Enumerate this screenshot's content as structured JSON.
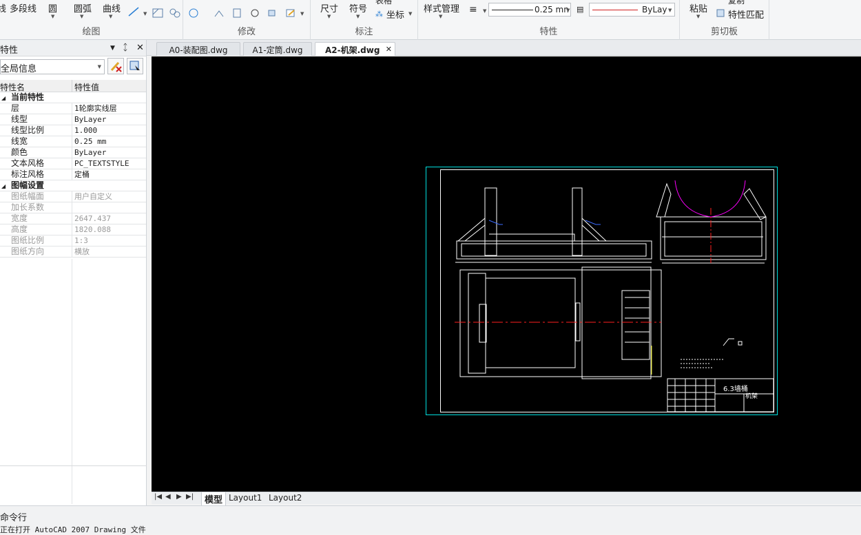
{
  "ribbon": {
    "draw": {
      "label": "绘图",
      "btn_line": "线",
      "btn_polyline": "多段线",
      "btn_circle": "圆",
      "btn_arc": "圆弧",
      "btn_curve": "曲线"
    },
    "modify": {
      "label": "修改"
    },
    "annotate": {
      "label": "标注",
      "btn_dimension": "尺寸",
      "btn_symbol": "符号",
      "btn_table": "表格",
      "btn_coord": "坐标"
    },
    "properties": {
      "label": "特性",
      "btn_style_mgr": "样式管理",
      "lineweight": "0.25 mn",
      "linetype": "ByLay"
    },
    "clipboard": {
      "label": "剪切板",
      "btn_paste": "粘贴",
      "btn_copy": "复制",
      "btn_match": "特性匹配"
    }
  },
  "props_panel": {
    "title": "特性",
    "selector": "全局信息",
    "col_name": "特性名",
    "col_value": "特性值",
    "cat_current": "当前特性",
    "rows_current": [
      {
        "k": "层",
        "v": "1轮廓实线层"
      },
      {
        "k": "线型",
        "v": "ByLayer"
      },
      {
        "k": "线型比例",
        "v": "1.000"
      },
      {
        "k": "线宽",
        "v": "0.25 mm"
      },
      {
        "k": "颜色",
        "v": "ByLayer"
      },
      {
        "k": "文本风格",
        "v": "PC_TEXTSTYLE"
      },
      {
        "k": "标注风格",
        "v": "定桶"
      }
    ],
    "cat_sheet": "图幅设置",
    "rows_sheet": [
      {
        "k": "图纸幅面",
        "v": "用户自定义"
      },
      {
        "k": "加长系数",
        "v": ""
      },
      {
        "k": "宽度",
        "v": "2647.437"
      },
      {
        "k": "高度",
        "v": "1820.088"
      },
      {
        "k": "图纸比例",
        "v": "1:3"
      },
      {
        "k": "图纸方向",
        "v": "横放"
      }
    ]
  },
  "doc_tabs": [
    "A0-装配图.dwg",
    "A1-定筒.dwg",
    "A2-机架.dwg"
  ],
  "layout_tabs": [
    "模型",
    "Layout1",
    "Layout2"
  ],
  "drawing": {
    "title_text": "6.3墙桶",
    "title_sub": "机架",
    "colors": {
      "border": "#00ffff",
      "line": "#ffffff",
      "center": "#ff2020",
      "arc": "#ff00ff",
      "dim": "#3a6bff"
    }
  },
  "command": {
    "title": "命令行",
    "message": "正在打开 AutoCAD 2007 Drawing 文件"
  }
}
